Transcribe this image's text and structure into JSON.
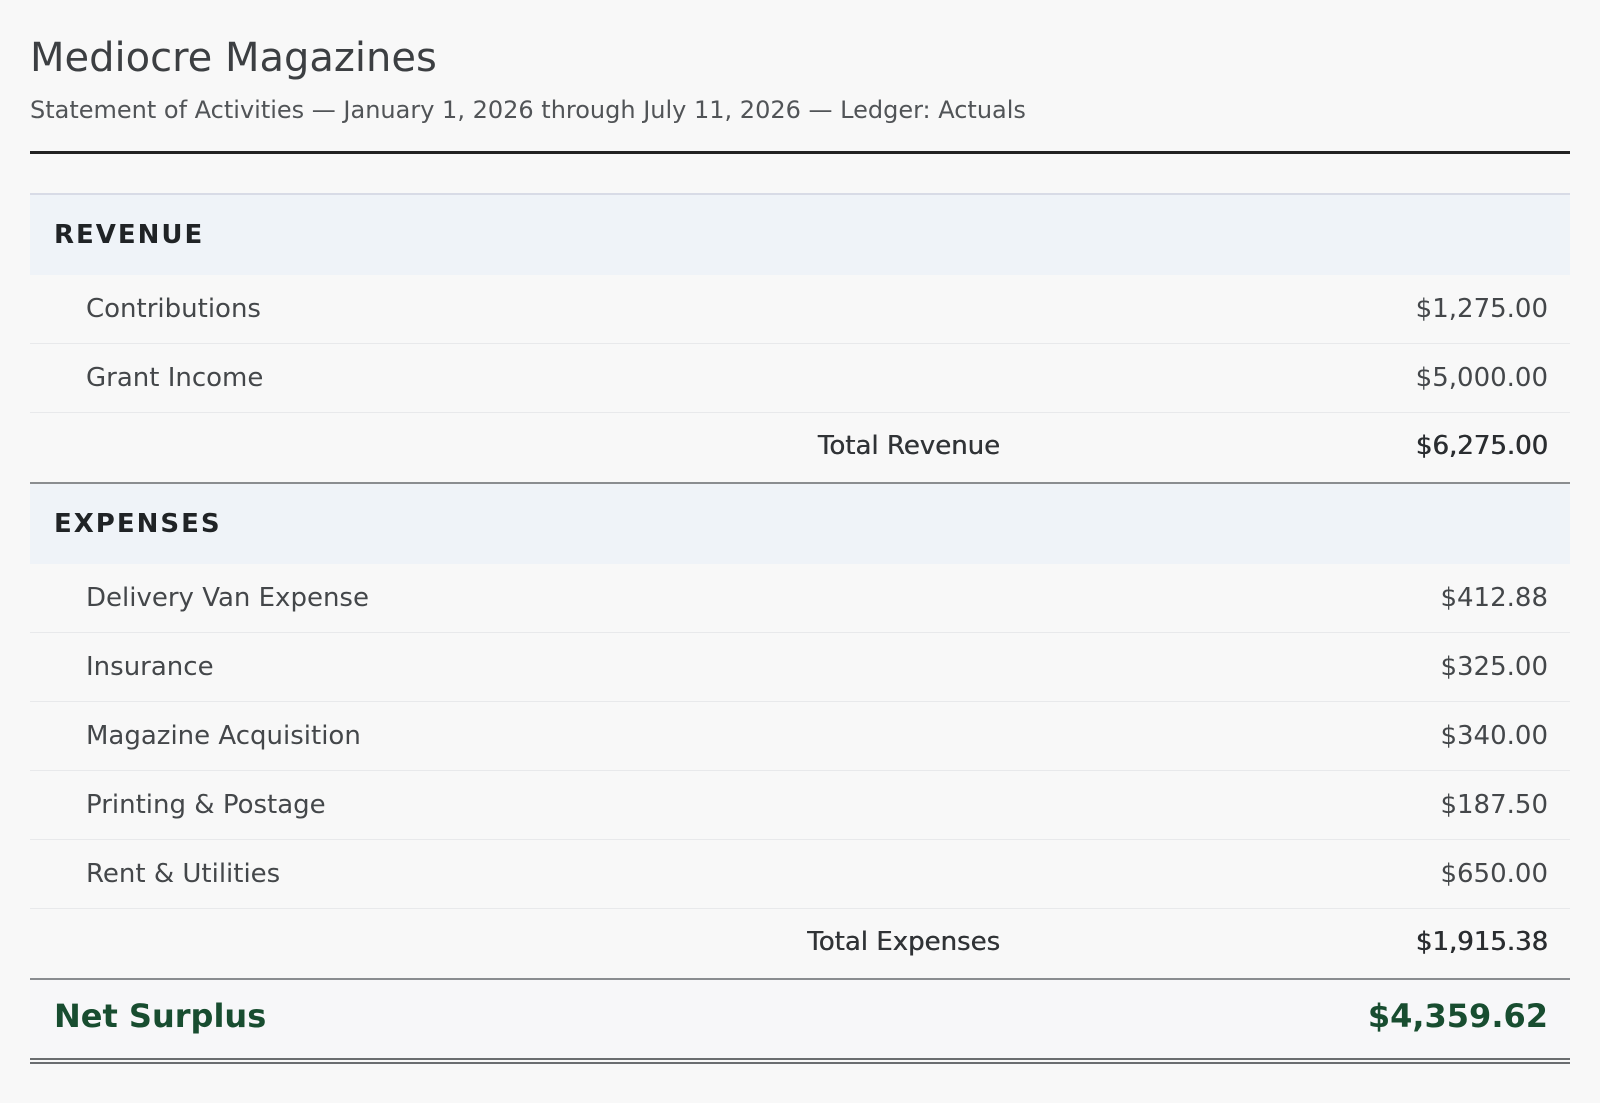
{
  "header": {
    "title": "Mediocre Magazines",
    "subtitle": "Statement of Activities — January 1, 2026 through July 11, 2026 — Ledger: Actuals"
  },
  "revenue": {
    "heading": "REVENUE",
    "items": [
      {
        "label": "Contributions",
        "amount": "$1,275.00"
      },
      {
        "label": "Grant Income",
        "amount": "$5,000.00"
      }
    ],
    "total_label": "Total Revenue",
    "total_amount": "$6,275.00"
  },
  "expenses": {
    "heading": "EXPENSES",
    "items": [
      {
        "label": "Delivery Van Expense",
        "amount": "$412.88"
      },
      {
        "label": "Insurance",
        "amount": "$325.00"
      },
      {
        "label": "Magazine Acquisition",
        "amount": "$340.00"
      },
      {
        "label": "Printing & Postage",
        "amount": "$187.50"
      },
      {
        "label": "Rent & Utilities",
        "amount": "$650.00"
      }
    ],
    "total_label": "Total Expenses",
    "total_amount": "$1,915.38"
  },
  "net": {
    "label": "Net Surplus",
    "amount": "$4,359.62"
  },
  "colors": {
    "net_text": "#184d30",
    "section_bg": "#eff3f8"
  }
}
